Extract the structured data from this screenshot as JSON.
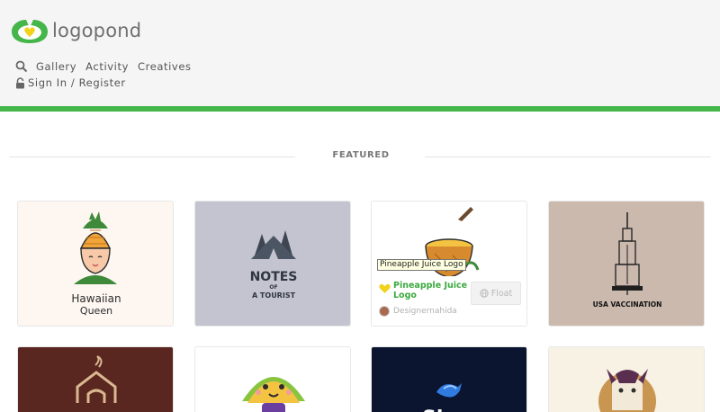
{
  "brand": {
    "name": "logopond",
    "accent": "#45b649"
  },
  "nav": {
    "search_icon": "search-icon",
    "items": [
      "Gallery",
      "Activity",
      "Creatives"
    ],
    "signin": "Sign In / Register"
  },
  "featured": {
    "heading": "FEATURED"
  },
  "cards": [
    {
      "art_text_1": "Hawaiian",
      "art_text_2": "Queen"
    },
    {
      "art_text_1": "NOTES",
      "art_text_2": "OF",
      "art_text_3": "A TOURIST"
    },
    {
      "title": "Pineapple Juice Logo",
      "designer": "Designernahida",
      "float_label": "Float",
      "tooltip": "Pineapple Juice Logo"
    },
    {
      "art_text_1": "USA VACCINATION"
    },
    {},
    {},
    {
      "art_text_1": "Sh"
    },
    {}
  ]
}
